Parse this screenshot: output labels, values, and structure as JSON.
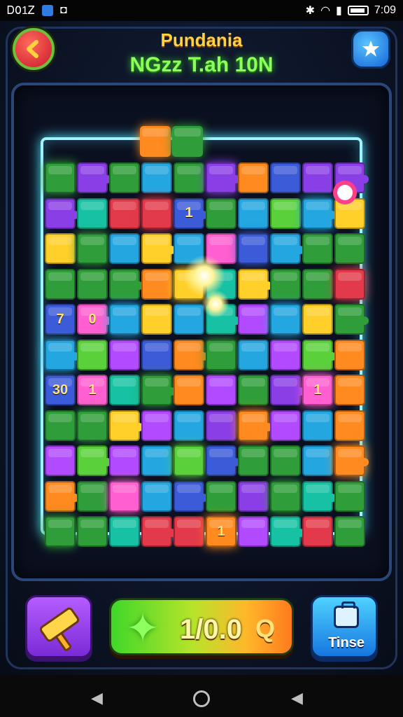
{
  "status": {
    "left_text": "Ꭰ𝟢1Ꮓ",
    "time": "7:09"
  },
  "header": {
    "title": "Pundania",
    "subtitle": "NGzz T.ah 10N"
  },
  "score": {
    "value": "1/0.0",
    "icon_text": "Q"
  },
  "buttons": {
    "hammer_label": "",
    "tinse_label": "Tinse"
  },
  "colors": {
    "accent_glow": "#9ff3ff",
    "title": "#ffd23f",
    "subtitle": "#8cff5a"
  },
  "icons": [
    "back-arrow-icon",
    "close-star-icon",
    "hammer-icon",
    "star-icon",
    "briefcase-icon",
    "target-icon"
  ],
  "tile_labels": [
    "1",
    "7",
    "0",
    "30",
    "1",
    "1",
    "1"
  ]
}
